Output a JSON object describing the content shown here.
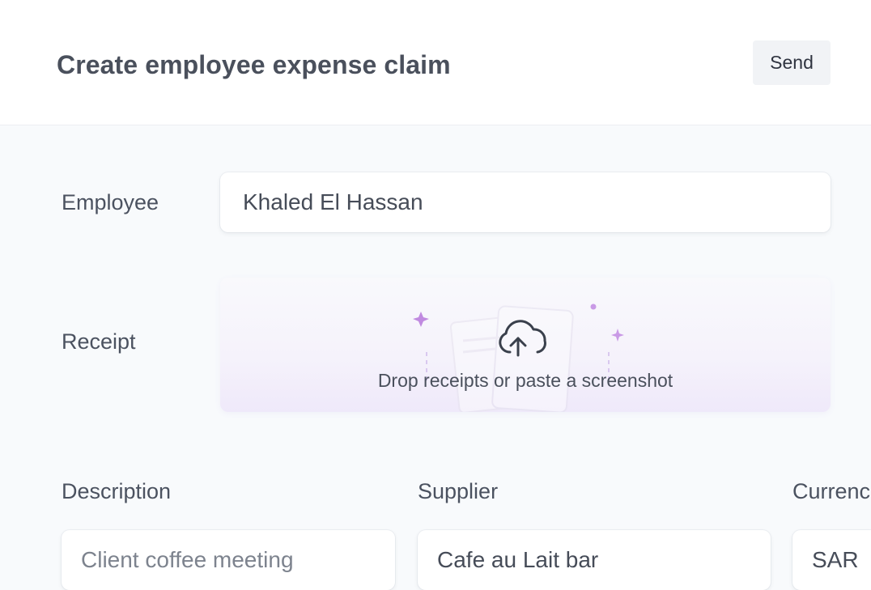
{
  "header": {
    "title": "Create employee expense claim",
    "send_label": "Send"
  },
  "form": {
    "employee": {
      "label": "Employee",
      "value": "Khaled El Hassan"
    },
    "receipt": {
      "label": "Receipt",
      "drop_text": "Drop receipts or paste a screenshot"
    },
    "description": {
      "label": "Description",
      "value": "Client coffee meeting"
    },
    "supplier": {
      "label": "Supplier",
      "value": "Cafe au Lait bar"
    },
    "currency": {
      "label": "Currenc",
      "value": "SAR"
    }
  },
  "icons": {
    "upload": "cloud-upload-icon",
    "sparkle": "sparkle-icon"
  },
  "colors": {
    "accent": "#c08ae0",
    "background": "#f8fafc",
    "header_bg": "#ffffff"
  }
}
